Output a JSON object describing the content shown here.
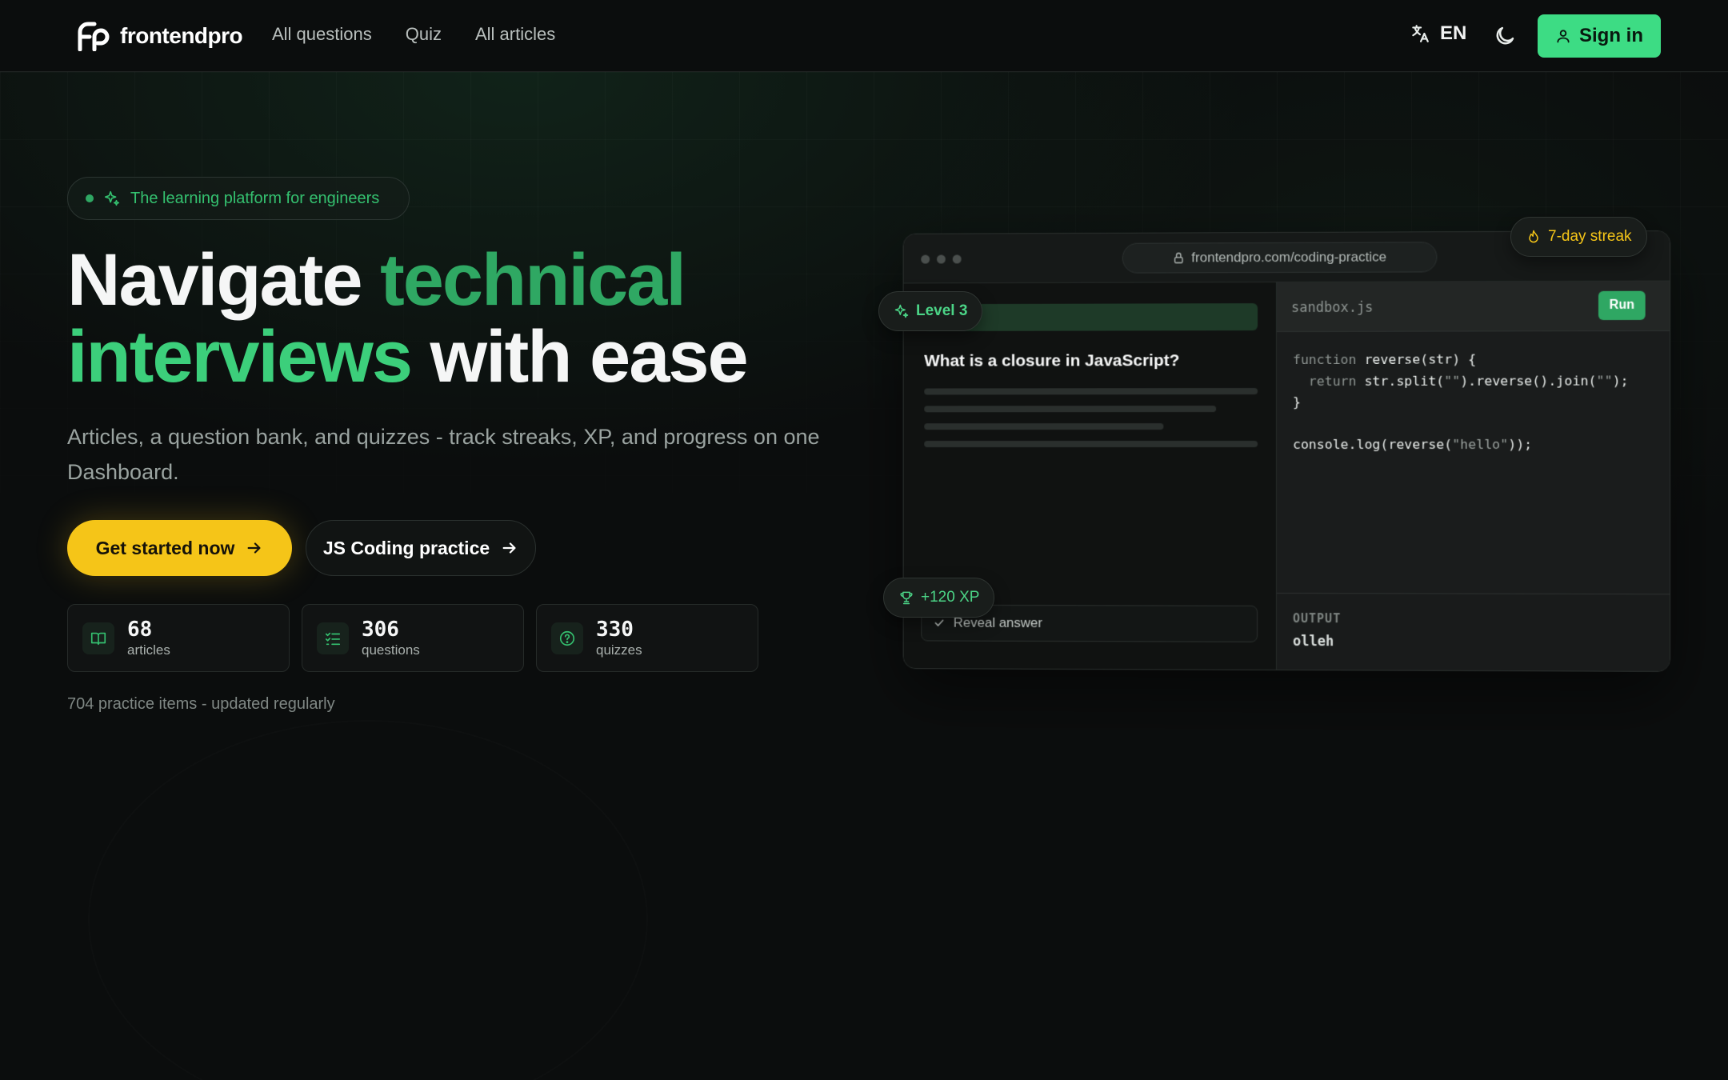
{
  "nav": {
    "brand": "frontendpro",
    "links": [
      "All questions",
      "Quiz",
      "All articles"
    ],
    "language": "EN",
    "sign_in": "Sign in"
  },
  "hero": {
    "pill": "The learning platform for engineers",
    "headline": {
      "part1": "Navigate ",
      "part2": "technical",
      "part3": "interviews",
      "part4": " with ease"
    },
    "subtitle": "Articles, a question bank, and quizzes - track streaks, XP, and progress on one Dashboard.",
    "cta_primary": "Get started now",
    "cta_secondary": "JS Coding practice",
    "stats": [
      {
        "value": "68",
        "label": "articles",
        "icon": "book-open-icon"
      },
      {
        "value": "306",
        "label": "questions",
        "icon": "list-checks-icon"
      },
      {
        "value": "330",
        "label": "quizzes",
        "icon": "help-circle-icon"
      }
    ],
    "practice_note": "704 practice items - updated regularly"
  },
  "mockup": {
    "url": "frontendpro.com/coding-practice",
    "question": "What is a closure in JavaScript?",
    "reveal": "Reveal answer",
    "filename": "sandbox.js",
    "run": "Run",
    "code": {
      "l1_kw": "function",
      "l1_rest": " reverse(str) {",
      "l2_kw": "  return",
      "l2_a": " str.split(",
      "l2_s1": "\"\"",
      "l2_b": ").reverse().join(",
      "l2_s2": "\"\"",
      "l2_c": ");",
      "l3": "}",
      "l5_a": "console.log(reverse(",
      "l5_s": "\"hello\"",
      "l5_b": "));"
    },
    "output_label": "OUTPUT",
    "output_value": "olleh"
  },
  "badges": {
    "streak": "7-day streak",
    "level": "Level 3",
    "xp": "+120 XP"
  },
  "colors": {
    "accent_green": "#3ddc84",
    "accent_yellow": "#f5c518",
    "background": "#0b0d0d"
  }
}
